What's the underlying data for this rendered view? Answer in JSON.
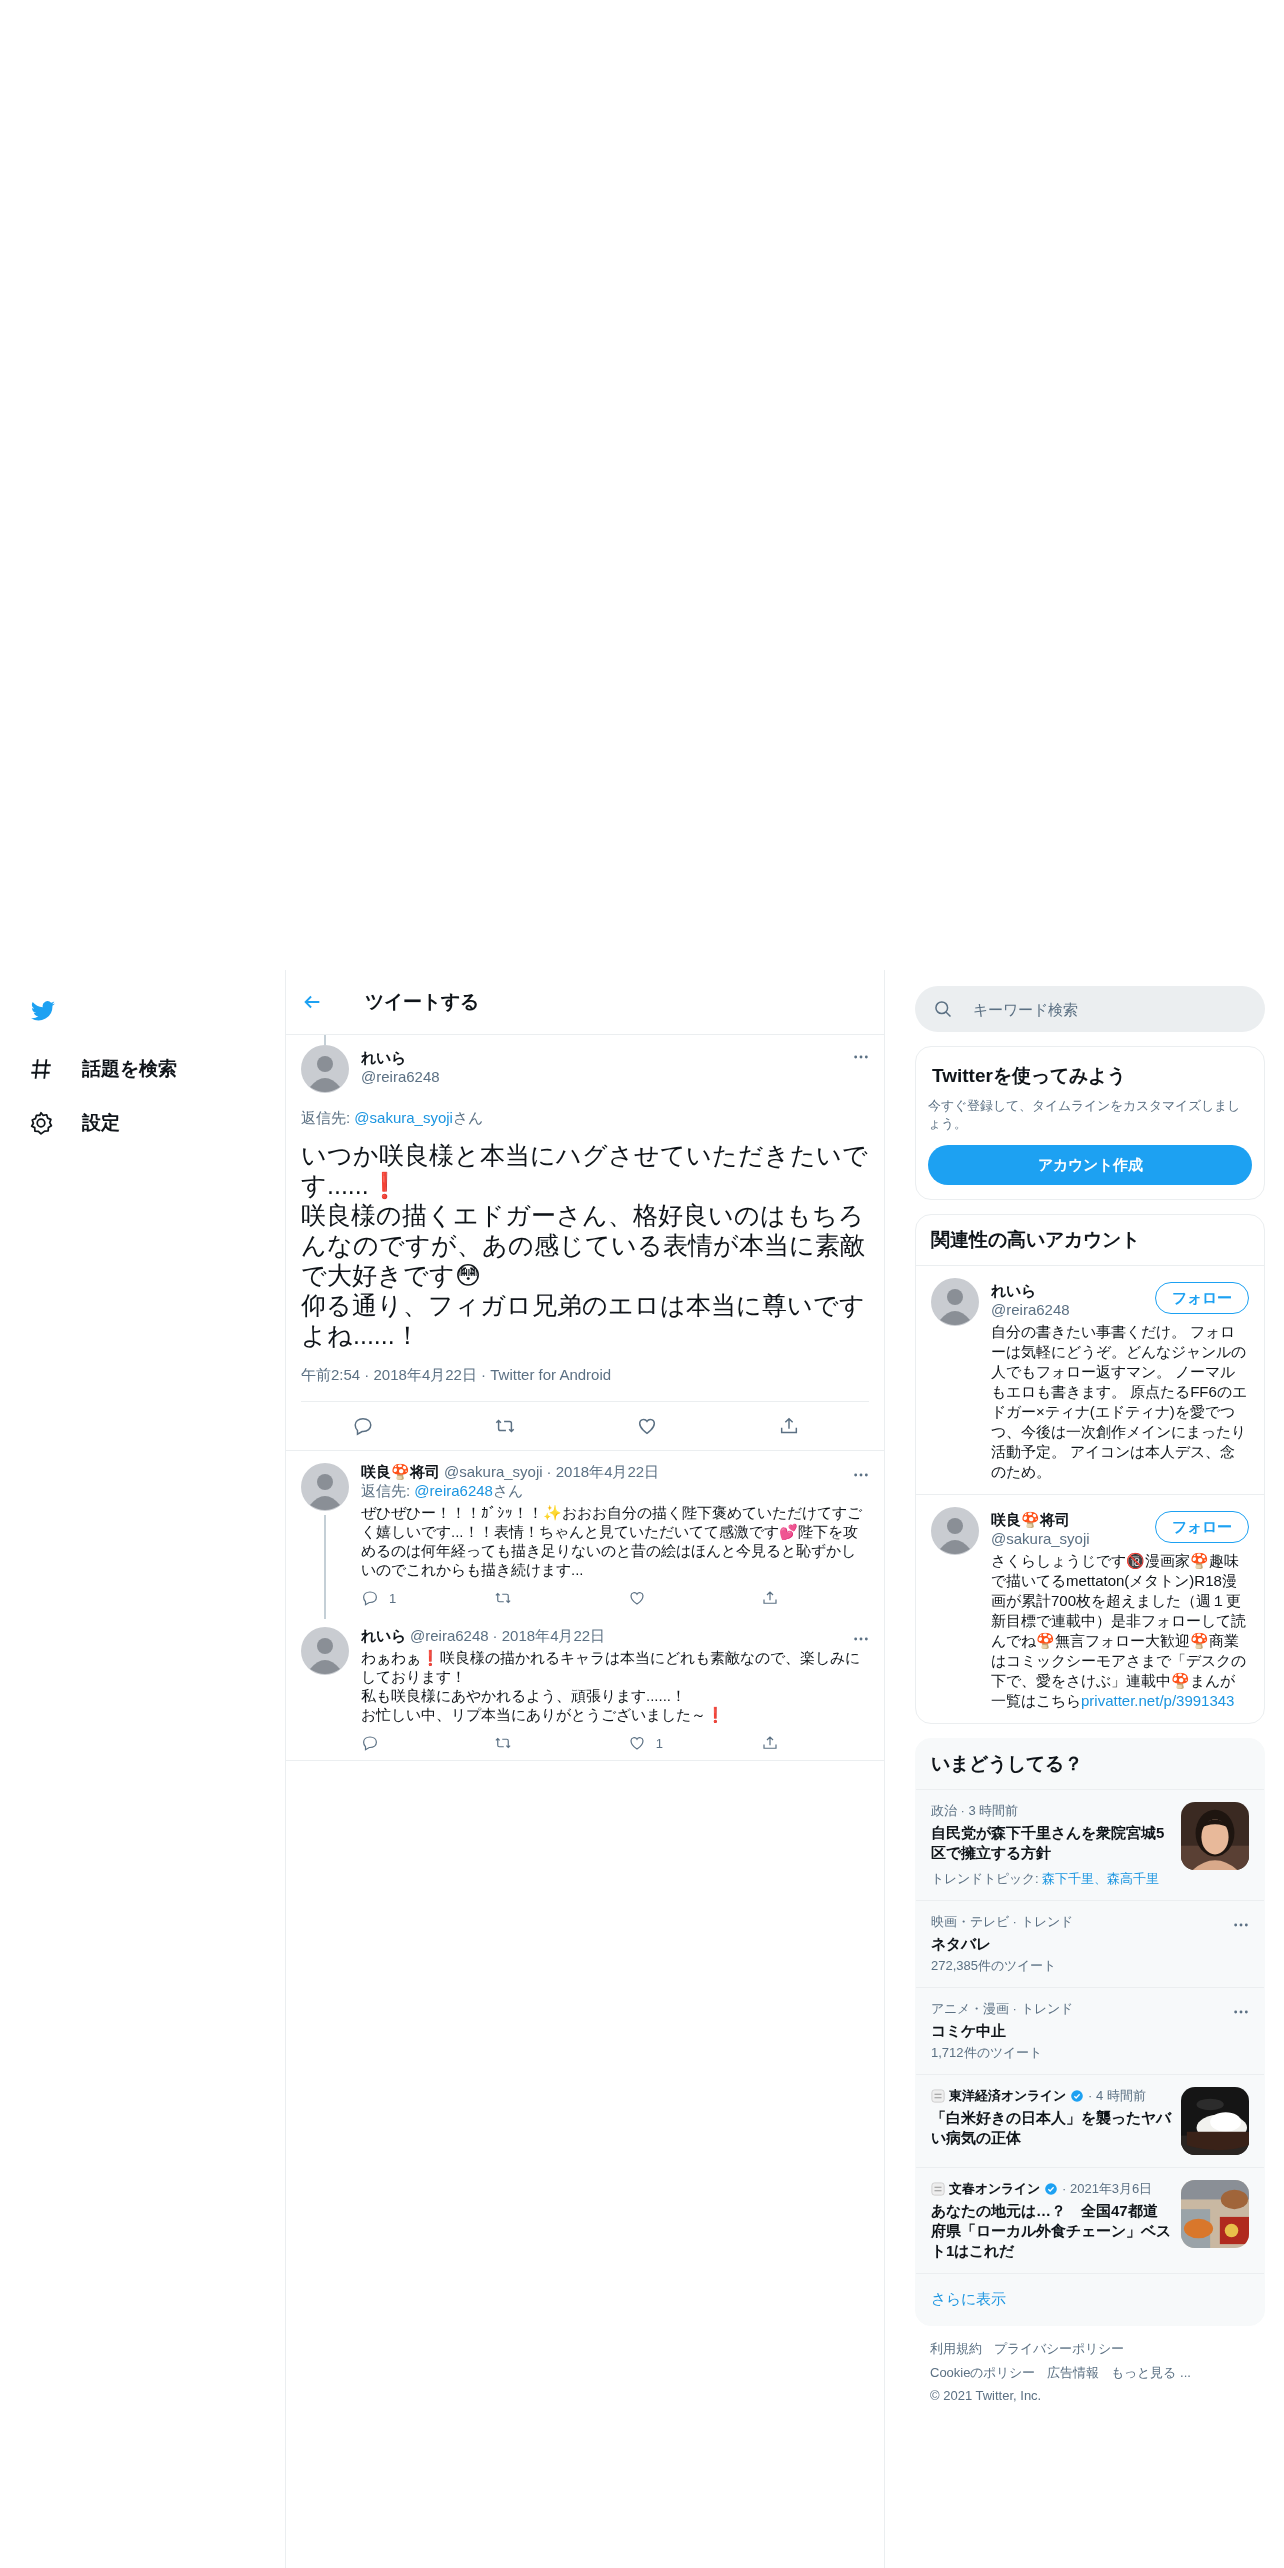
{
  "sidebar": {
    "items": [
      {
        "kind": "hash",
        "label": "話題を検索"
      },
      {
        "kind": "gear",
        "label": "設定"
      }
    ]
  },
  "header": {
    "title": "ツイートする"
  },
  "main_tweet": {
    "name": "れいら",
    "handle": "@reira6248",
    "reply_to_prefix": "返信先: ",
    "reply_to": "@sakura_syoji",
    "reply_to_suffix": "さん",
    "lines": [
      "いつか咲良様と本当にハグさせていただきたいです......❗",
      "咲良様の描くエドガーさん、格好良いのはもちろんなのですが、あの感じている表情が本当に素敵で大好きです😳",
      "仰る通り、フィガロ兄弟のエロは本当に尊いですよね......！"
    ],
    "meta": "午前2:54 · 2018年4月22日 · Twitter for Android"
  },
  "replies": [
    {
      "name": "咲良🍄将司",
      "handle": "@sakura_syoji",
      "date": " · 2018年4月22日",
      "reply_to_prefix": "返信先: ",
      "reply_to": "@reira6248",
      "reply_to_suffix": "さん",
      "lines": [
        "ぜひぜひー！！！ｶﾞｼｯ！！✨おおお自分の描く陛下褒めていただけてすごく嬉しいです...！！表情！ちゃんと見ていただいてて感激です💕陛下を攻めるのは何年経っても描き足りないのと昔の絵はほんと今見ると恥ずかしいのでこれからも描き続けます..."
      ],
      "reply_count": "1",
      "thread_below": true
    },
    {
      "name": "れいら",
      "handle": "@reira6248",
      "date": " · 2018年4月22日",
      "lines": [
        "わぁわぁ❗咲良様の描かれるキャラは本当にどれも素敵なので、楽しみにしております！",
        "私も咲良様にあやかれるよう、頑張ります......！",
        "お忙しい中、リプ本当にありがとうございました～❗"
      ],
      "like_count": "1",
      "thread_below": false
    }
  ],
  "search": {
    "placeholder": "キーワード検索"
  },
  "signup": {
    "title": "Twitterを使ってみよう",
    "text": "今すぐ登録して、タイムラインをカスタマイズしましょう。",
    "button": "アカウント作成"
  },
  "who_to_follow": {
    "title": "関連性の高いアカウント",
    "accounts": [
      {
        "name": "れいら",
        "handle": "@reira6248",
        "button": "フォロー",
        "bio": "自分の書きたい事書くだけ。 フォローは気軽にどうぞ。どんなジャンルの人でもフォロー返すマン。 ノーマルもエロも書きます。 原点たるFF6のエドガー×ティナ(エドティナ)を愛でつつ、今後は一次創作メインにまったり活動予定。 アイコンは本人デス、念のため。"
      },
      {
        "name": "咲良🍄将司",
        "handle": "@sakura_syoji",
        "button": "フォロー",
        "bio": "さくらしょうじです🔞漫画家🍄趣味で描いてるmettaton(メタトン)R18漫画が累計700枚を超えました（週１更新目標で連載中）是非フォローして読んでね🍄無言フォロー大歓迎🍄商業はコミックシーモアさまで「デスクの下で、愛をさけぶ」連載中🍄まんが一覧はこちら",
        "bio_link": "privatter.net/p/3991343"
      }
    ]
  },
  "trends": {
    "title": "いまどうしてる？",
    "items": [
      {
        "kind": "news",
        "context": "政治 · 3 時間前",
        "headline": "自民党が森下千里さんを衆院宮城5区で擁立する方針",
        "topics_prefix": "トレンドトピック: ",
        "topics": "森下千里、森高千里"
      },
      {
        "kind": "trend",
        "context": "映画・テレビ · トレンド",
        "headline": "ネタバレ",
        "count": "272,385件のツイート"
      },
      {
        "kind": "trend",
        "context": "アニメ・漫画 · トレンド",
        "headline": "コミケ中止",
        "count": "1,712件のツイート"
      },
      {
        "kind": "article",
        "source": "東洋経済オンライン",
        "verified": true,
        "time": " · 4 時間前",
        "headline": "「白米好きの日本人」を襲ったヤバい病気の正体"
      },
      {
        "kind": "article",
        "source": "文春オンライン",
        "verified": true,
        "time": " · 2021年3月6日",
        "headline": "あなたの地元は…？　全国47都道府県「ローカル外食チェーン」ベスト1はこれだ"
      }
    ],
    "show_more": "さらに表示"
  },
  "footer": {
    "links": [
      "利用規約",
      "プライバシーポリシー",
      "Cookieのポリシー",
      "広告情報",
      "もっと見る ..."
    ],
    "copyright": "© 2021 Twitter, Inc."
  }
}
